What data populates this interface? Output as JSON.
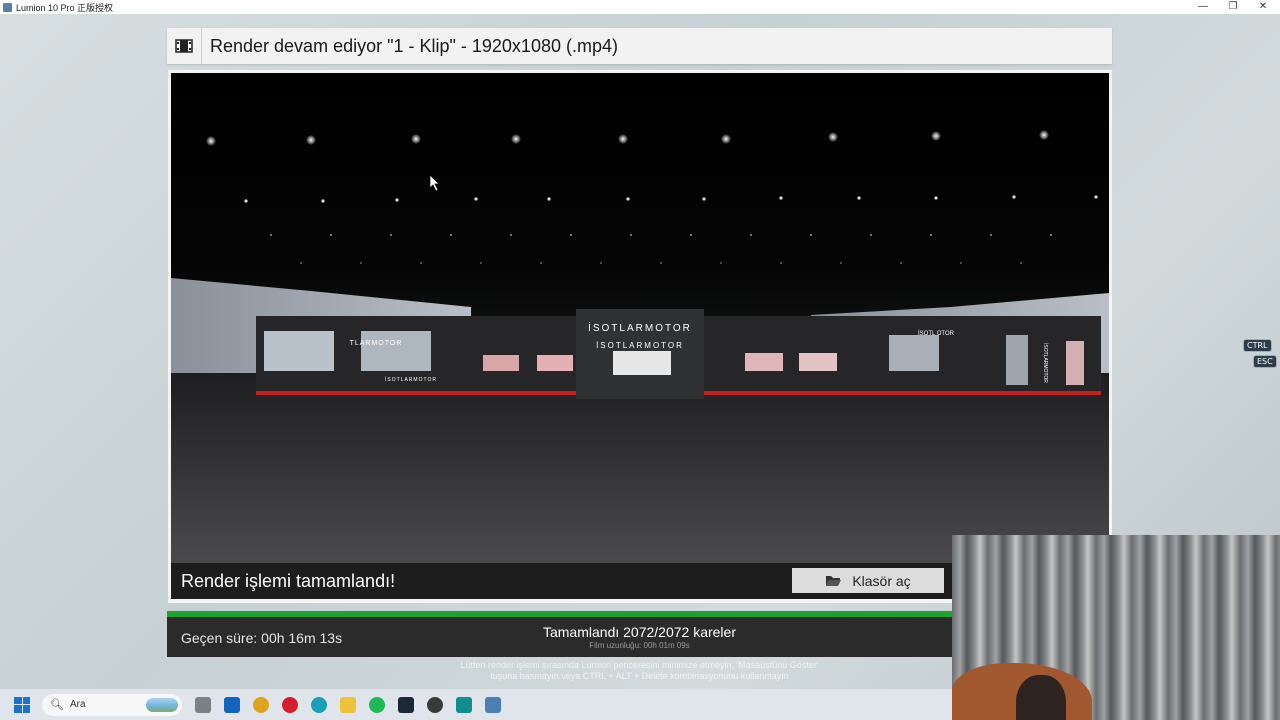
{
  "window": {
    "title": "Lumion 10 Pro 正版授权",
    "controls": [
      "—",
      "❐",
      "✕"
    ]
  },
  "header": {
    "title": "Render devam ediyor \"1 - Klip\" - 1920x1080 (.mp4)",
    "icon": "film-icon"
  },
  "preview": {
    "sign_main": "İSOTLARMOTOR",
    "sign_center": "İSOTLARMOTOR",
    "sign_left": "TLARMOTOR",
    "sign_right_partial": "İSOTL    OTOR",
    "sign_vertical": "İSOTLARMOTOR",
    "base_text": "İSOTLARMOTOR"
  },
  "status": {
    "message": "Render işlemi tamamlandı!",
    "open_folder_label": "Klasör aç",
    "open_folder_icon": "folder-open-icon"
  },
  "progress": {
    "fraction": 1.0,
    "color": "#1fa12f",
    "elapsed": "Geçen süre: 00h 16m 13s",
    "frames": "Tamamlandı 2072/2072 kareler",
    "film_length": "Film uzunluğu: 00h 01m 09s"
  },
  "warning": {
    "line1": "Lütfen render işlemi sırasında Lumion penceresini minimize etmeyin, 'Masaüstünü Göster'",
    "line2": "tuşuna basmayın veya CTRL + ALT + Delete kombinasyonunu kullanmayın"
  },
  "keys": {
    "ctrl": "CTRL",
    "esc": "ESC"
  },
  "taskbar": {
    "search_placeholder": "Ara",
    "apps": [
      "file-explorer-icon",
      "outlook-icon",
      "chrome-icon",
      "opera-icon",
      "edge-icon",
      "folder-icon",
      "spotify-icon",
      "steam-icon",
      "obs-icon",
      "3ds-max-icon",
      "lumion-icon"
    ]
  }
}
